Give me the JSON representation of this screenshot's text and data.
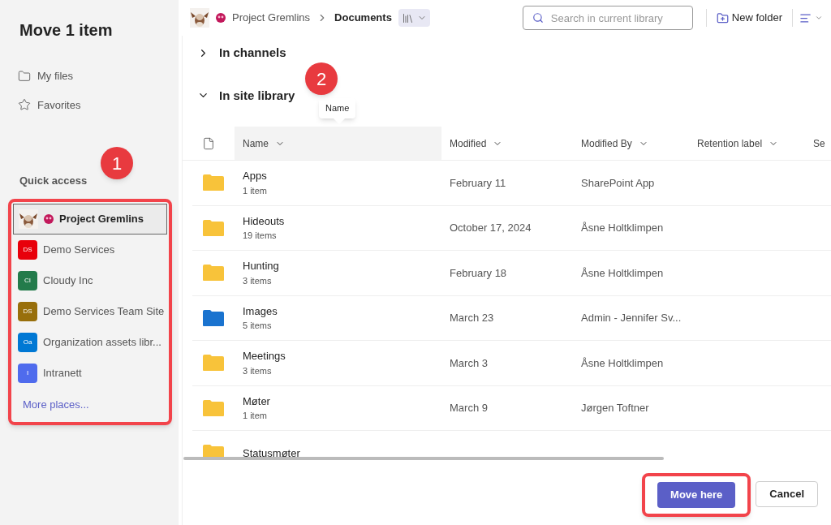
{
  "dialog": {
    "title": "Move 1 item"
  },
  "nav": [
    {
      "label": "My files",
      "kind": "folder"
    },
    {
      "label": "Favorites",
      "kind": "star"
    }
  ],
  "quick_access": {
    "heading": "Quick access",
    "sites": [
      {
        "label": "Project Gremlins",
        "kind": "picture",
        "selected": true
      },
      {
        "label": "Demo Services",
        "kind": "tile",
        "initials": "DS",
        "color": "#e8000b",
        "selected": false
      },
      {
        "label": "Cloudy Inc",
        "kind": "tile",
        "initials": "CI",
        "color": "#237b4b",
        "selected": false
      },
      {
        "label": "Demo Services Team Site",
        "kind": "tile",
        "initials": "DS",
        "color": "#986f0b",
        "selected": false
      },
      {
        "label": "Organization assets libr...",
        "kind": "tile",
        "initials": "Oa",
        "color": "#0078d4",
        "selected": false
      },
      {
        "label": "Intranett",
        "kind": "tile",
        "initials": "I",
        "color": "#4f6bed",
        "selected": false
      }
    ],
    "more_link": "More places..."
  },
  "breadcrumb": [
    {
      "label": "Project Gremlins",
      "current": false
    },
    {
      "label": "Documents",
      "current": true
    }
  ],
  "search": {
    "placeholder": "Search in current library"
  },
  "toolbar": {
    "new_folder": "New folder"
  },
  "sections": [
    {
      "label": "In channels",
      "expanded": false
    },
    {
      "label": "In site library",
      "expanded": true
    }
  ],
  "tooltip": "Name",
  "table": {
    "columns": [
      "Name",
      "Modified",
      "Modified By",
      "Retention label",
      "Se"
    ],
    "rows": [
      {
        "name": "Apps",
        "count": "1 item",
        "modified": "February 11",
        "modified_by": "SharePoint App",
        "color": "#f8c33a"
      },
      {
        "name": "Hideouts",
        "count": "19 items",
        "modified": "October 17, 2024",
        "modified_by": "Åsne Holtklimpen",
        "color": "#f8c33a"
      },
      {
        "name": "Hunting",
        "count": "3 items",
        "modified": "February 18",
        "modified_by": "Åsne Holtklimpen",
        "color": "#f8c33a"
      },
      {
        "name": "Images",
        "count": "5 items",
        "modified": "March 23",
        "modified_by": "Admin - Jennifer Sv...",
        "color": "#1a73cf"
      },
      {
        "name": "Meetings",
        "count": "3 items",
        "modified": "March 3",
        "modified_by": "Åsne Holtklimpen",
        "color": "#f8c33a"
      },
      {
        "name": "Møter",
        "count": "1 item",
        "modified": "March 9",
        "modified_by": "Jørgen Toftner",
        "color": "#f8c33a"
      },
      {
        "name": "Statusmøter",
        "color": "#f8c33a"
      }
    ]
  },
  "buttons": [
    {
      "label": "Move here",
      "kind": "primary"
    },
    {
      "label": "Cancel",
      "kind": "secondary"
    }
  ],
  "callouts": [
    "1",
    "2"
  ]
}
